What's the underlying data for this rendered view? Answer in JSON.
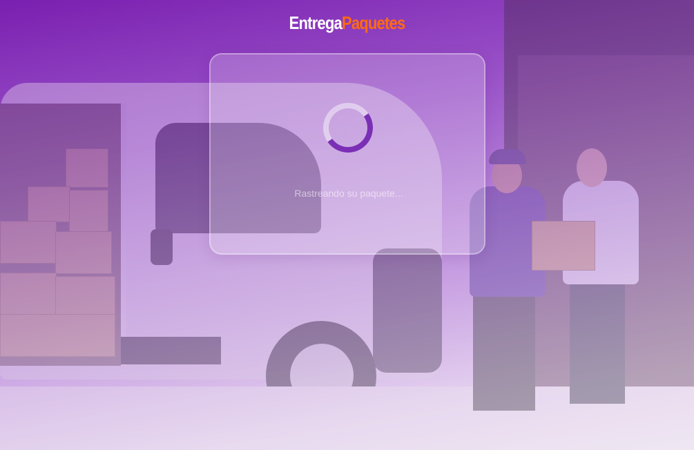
{
  "brand": {
    "part1": "Entrega",
    "part2": "Paquetes",
    "part1_color": "#ffffff",
    "part2_color": "#ff6a13"
  },
  "loader": {
    "status_text": "Rastreando su paquete...",
    "spinner_icon": "spinner-icon",
    "accent_color": "#7a2fb5"
  },
  "background": {
    "image_alt": "Delivery van with courier handing a package to a customer",
    "overlay_colors": [
      "#7a1fb0",
      "#f1e8f5"
    ]
  }
}
